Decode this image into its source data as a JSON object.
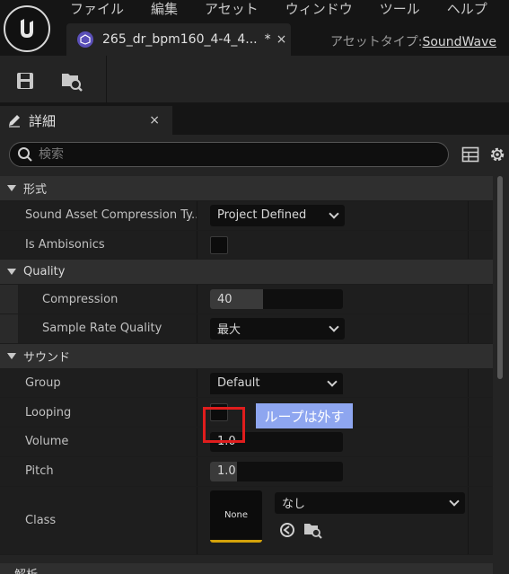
{
  "menu": [
    "ファイル",
    "編集",
    "アセット",
    "ウィンドウ",
    "ツール",
    "ヘルプ"
  ],
  "tab": {
    "label": "265_dr_bpm160_4-4_4...",
    "modified": "*",
    "close": "×"
  },
  "asset_type": {
    "label": "アセットタイプ:",
    "value": "SoundWave"
  },
  "details": {
    "title": "詳細",
    "close": "×"
  },
  "search": {
    "placeholder": "検索"
  },
  "categories": {
    "format": "形式",
    "quality": "Quality",
    "sound": "サウンド",
    "analysis": "解析"
  },
  "props": {
    "compression_type": {
      "name": "Sound Asset Compression Ty...",
      "value": "Project Defined"
    },
    "is_ambisonics": {
      "name": "Is Ambisonics",
      "checked": false
    },
    "compression": {
      "name": "Compression",
      "value": "40",
      "fill_percent": 40
    },
    "sample_rate_quality": {
      "name": "Sample Rate Quality",
      "value": "最大"
    },
    "group": {
      "name": "Group",
      "value": "Default"
    },
    "looping": {
      "name": "Looping",
      "checked": false
    },
    "volume": {
      "name": "Volume",
      "value": "1.0"
    },
    "pitch": {
      "name": "Pitch",
      "value": "1.0",
      "fill_percent": 20
    },
    "class": {
      "name": "Class",
      "thumb": "None",
      "value": "なし"
    }
  },
  "annotation": {
    "text": "ループは外す",
    "color": "#e01d1d"
  }
}
